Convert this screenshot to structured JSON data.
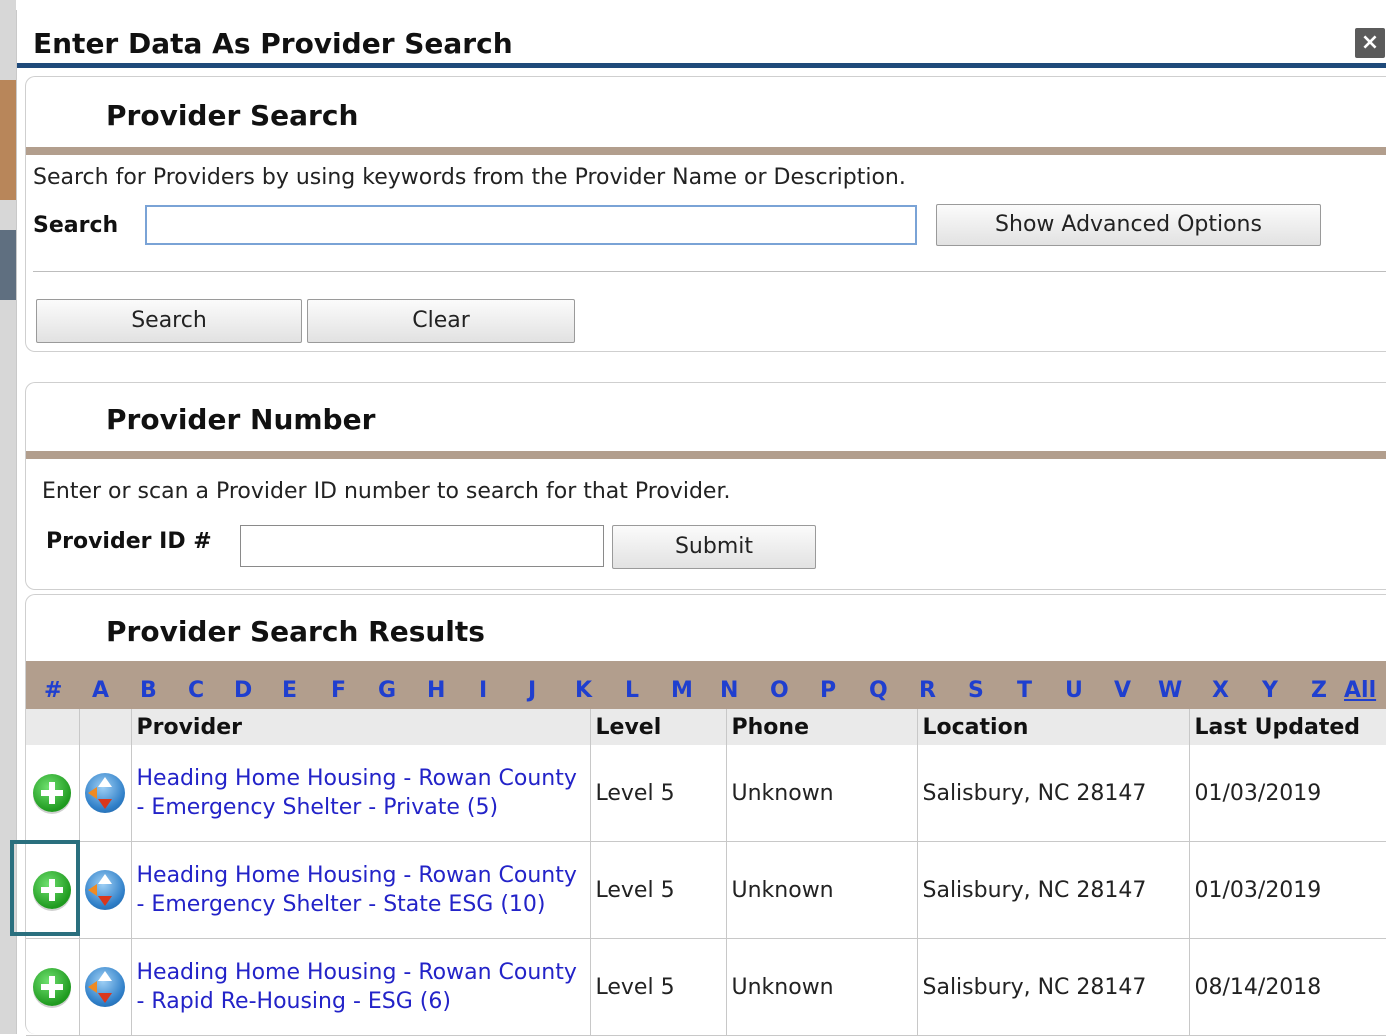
{
  "dialog": {
    "title": "Enter Data As Provider Search",
    "close_icon": "close-icon"
  },
  "provider_search": {
    "title": "Provider Search",
    "description": "Search for Providers by using keywords from the Provider Name or Description.",
    "search_label": "Search",
    "search_value": "",
    "advanced_button": "Show Advanced Options",
    "search_button": "Search",
    "clear_button": "Clear"
  },
  "provider_number": {
    "title": "Provider Number",
    "description": "Enter or scan a Provider ID number to search for that Provider.",
    "id_label": "Provider ID #",
    "id_value": "",
    "submit_button": "Submit"
  },
  "results": {
    "title": "Provider Search Results",
    "alphabet": [
      "#",
      "A",
      "B",
      "C",
      "D",
      "E",
      "F",
      "G",
      "H",
      "I",
      "J",
      "K",
      "L",
      "M",
      "N",
      "O",
      "P",
      "Q",
      "R",
      "S",
      "T",
      "U",
      "V",
      "W",
      "X",
      "Y",
      "Z",
      "All"
    ],
    "columns": [
      "Provider",
      "Level",
      "Phone",
      "Location",
      "Last Updated"
    ],
    "rows": [
      {
        "provider": "Heading Home Housing - Rowan County - Emergency Shelter - Private (5)",
        "level": "Level 5",
        "phone": "Unknown",
        "location": "Salisbury, NC 28147",
        "last_updated": "01/03/2019"
      },
      {
        "provider": "Heading Home Housing - Rowan County - Emergency Shelter - State ESG (10)",
        "level": "Level 5",
        "phone": "Unknown",
        "location": "Salisbury, NC 28147",
        "last_updated": "01/03/2019"
      },
      {
        "provider": "Heading Home Housing - Rowan County - Rapid Re-Housing - ESG (6)",
        "level": "Level 5",
        "phone": "Unknown",
        "location": "Salisbury, NC 28147",
        "last_updated": "08/14/2018"
      }
    ]
  },
  "colors": {
    "header_rule": "#1f4a7a",
    "section_rule": "#b29e8d",
    "link": "#2323c8",
    "highlight": "#2a6f7e"
  }
}
